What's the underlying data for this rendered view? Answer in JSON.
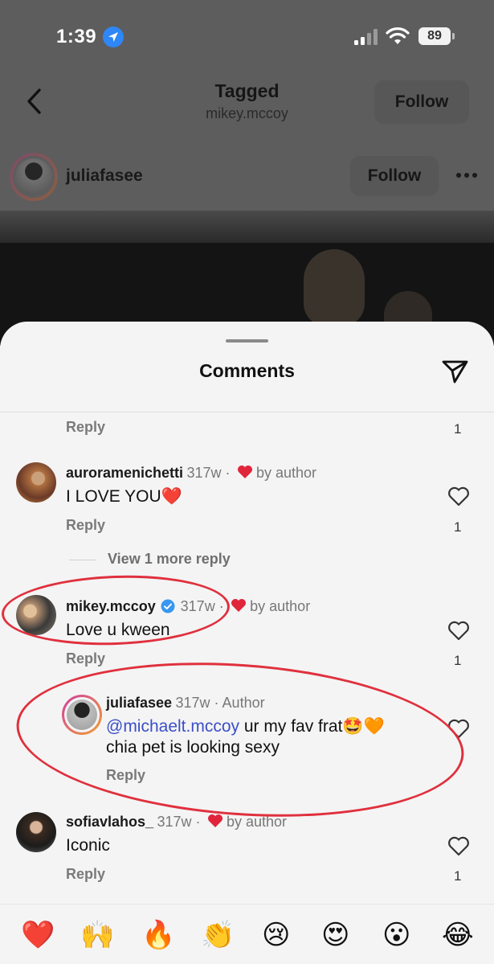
{
  "status_bar": {
    "time": "1:39",
    "battery": "89"
  },
  "nav": {
    "title": "Tagged",
    "subtitle": "mikey.mccoy",
    "follow_label": "Follow"
  },
  "post": {
    "username": "juliafasee",
    "follow_label": "Follow"
  },
  "sheet": {
    "title": "Comments"
  },
  "reply_label": "Reply",
  "comments": [
    {
      "reply_count": "1"
    },
    {
      "username": "auroramenichetti",
      "time": "317w",
      "liked_by": "by author",
      "text": "I LOVE YOU❤️",
      "reply_count": "1",
      "view_more": "View 1 more reply"
    },
    {
      "username": "mikey.mccoy",
      "verified": true,
      "time": "317w",
      "liked_by": "by author",
      "text": "Love u kween",
      "reply_count": "1"
    },
    {
      "username": "juliafasee",
      "time": "317w",
      "tag": "Author",
      "mention": "@michaelt.mccoy",
      "text_line1": "ur my fav frat🤩🧡",
      "text_line2": "chia pet is looking sexy"
    },
    {
      "username": "sofiavlahos_",
      "time": "317w",
      "liked_by": "by author",
      "text": "Iconic",
      "reply_count": "1"
    }
  ],
  "emoji_bar": [
    "❤️",
    "🙌",
    "🔥",
    "👏",
    "😢",
    "😍",
    "😮",
    "😂"
  ],
  "colors": {
    "accent_blue": "#3b4fc7",
    "heart_red": "#e0253b",
    "annotation_red": "#e0303d",
    "verified_blue": "#3897f0"
  }
}
